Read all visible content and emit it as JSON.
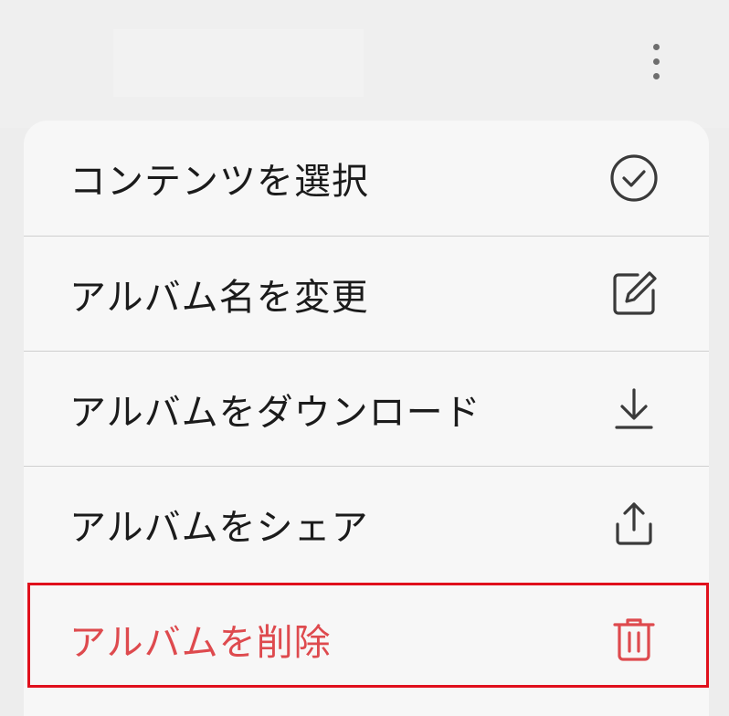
{
  "header": {
    "more_icon": "more-vertical-icon"
  },
  "menu": {
    "items": [
      {
        "label": "コンテンツを選択",
        "icon": "check-circle-icon"
      },
      {
        "label": "アルバム名を変更",
        "icon": "edit-square-icon"
      },
      {
        "label": "アルバムをダウンロード",
        "icon": "download-icon"
      },
      {
        "label": "アルバムをシェア",
        "icon": "share-icon"
      },
      {
        "label": "アルバムを削除",
        "icon": "trash-icon"
      }
    ]
  },
  "colors": {
    "danger": "#de4a4e",
    "highlight": "#e0101c",
    "text": "#1b1b1b",
    "icon": "#3a3a3a"
  }
}
